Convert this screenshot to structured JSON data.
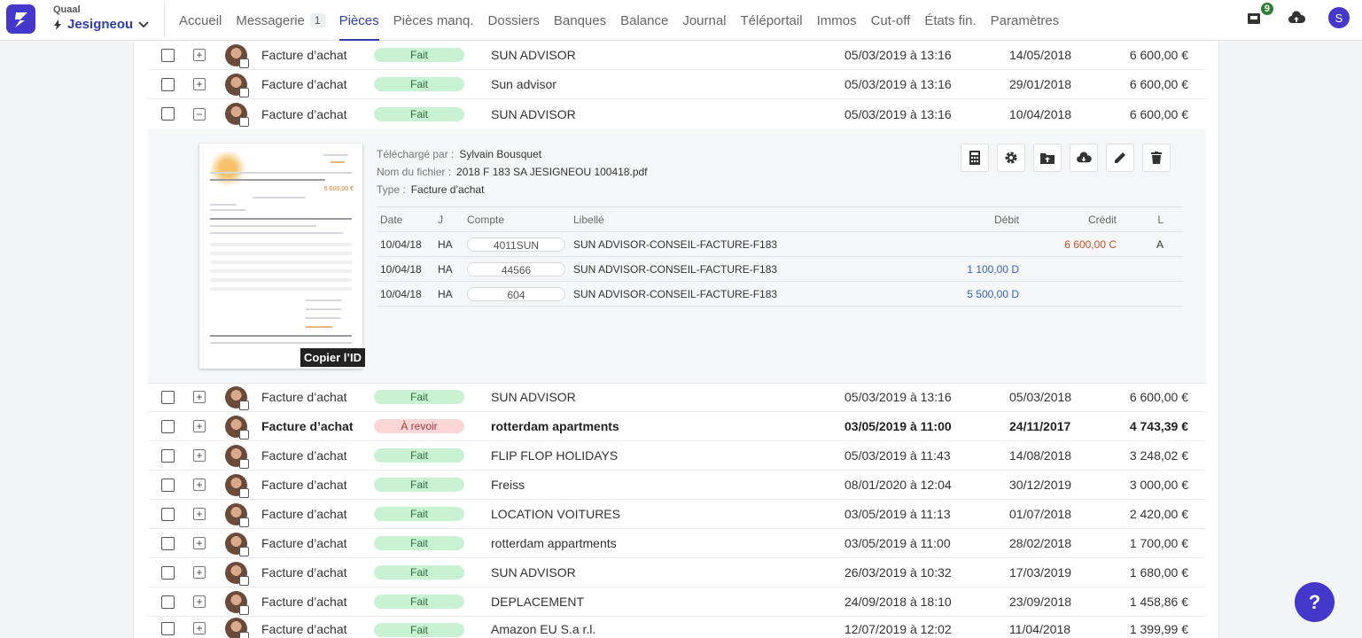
{
  "header": {
    "company_label": "Quaal",
    "company_name": "Jesigneou",
    "nav": [
      {
        "label": "Accueil"
      },
      {
        "label": "Messagerie",
        "badge": "1"
      },
      {
        "label": "Pièces",
        "active": true
      },
      {
        "label": "Pièces manq."
      },
      {
        "label": "Dossiers"
      },
      {
        "label": "Banques"
      },
      {
        "label": "Balance"
      },
      {
        "label": "Journal"
      },
      {
        "label": "Téléportail"
      },
      {
        "label": "Immos"
      },
      {
        "label": "Cut-off"
      },
      {
        "label": "États fin."
      },
      {
        "label": "Paramètres"
      }
    ],
    "notif_count": "9",
    "user_initial": "S"
  },
  "rows_top": [
    {
      "type": "Facture d’achat",
      "status": "Fait",
      "vendor": "SUN ADVISOR",
      "uploaded": "05/03/2019 à 13:16",
      "date": "14/05/2018",
      "amount": "6 600,00 €"
    },
    {
      "type": "Facture d’achat",
      "status": "Fait",
      "vendor": "Sun advisor",
      "uploaded": "05/03/2019 à 13:16",
      "date": "29/01/2018",
      "amount": "6 600,00 €"
    },
    {
      "type": "Facture d’achat",
      "status": "Fait",
      "vendor": "SUN ADVISOR",
      "uploaded": "05/03/2019 à 13:16",
      "date": "10/04/2018",
      "amount": "6 600,00 €"
    }
  ],
  "detail": {
    "uploaded_by_label": "Téléchargé par :",
    "uploaded_by": "Sylvain Bousquet",
    "filename_label": "Nom du fichier :",
    "filename": "2018 F 183 SA JESIGNEOU 100418.pdf",
    "type_label": "Type :",
    "type": "Facture d’achat",
    "copy_id": "Copier l’ID",
    "thumb_price": "6 600,00 €",
    "columns": {
      "date": "Date",
      "journal": "J",
      "account": "Compte",
      "label": "Libellé",
      "debit": "Débit",
      "credit": "Crédit",
      "letter": "L"
    },
    "entries": [
      {
        "date": "10/04/18",
        "journal": "HA",
        "account": "4011SUN",
        "label": "SUN ADVISOR-CONSEIL-FACTURE-F183",
        "debit": "",
        "credit": "6 600,00 C",
        "letter": "A"
      },
      {
        "date": "10/04/18",
        "journal": "HA",
        "account": "44566",
        "label": "SUN ADVISOR-CONSEIL-FACTURE-F183",
        "debit": "1 100,00 D",
        "credit": "",
        "letter": ""
      },
      {
        "date": "10/04/18",
        "journal": "HA",
        "account": "604",
        "label": "SUN ADVISOR-CONSEIL-FACTURE-F183",
        "debit": "5 500,00 D",
        "credit": "",
        "letter": ""
      }
    ]
  },
  "rows_bottom": [
    {
      "type": "Facture d’achat",
      "status": "Fait",
      "vendor": "SUN ADVISOR",
      "uploaded": "05/03/2019 à 13:16",
      "date": "05/03/2018",
      "amount": "6 600,00 €"
    },
    {
      "type": "Facture d’achat",
      "status": "À revoir",
      "vendor": "rotterdam apartments",
      "uploaded": "03/05/2019 à 11:00",
      "date": "24/11/2017",
      "amount": "4 743,39 €",
      "bold": true
    },
    {
      "type": "Facture d’achat",
      "status": "Fait",
      "vendor": "FLIP FLOP HOLIDAYS",
      "uploaded": "05/03/2019 à 11:43",
      "date": "14/08/2018",
      "amount": "3 248,02 €"
    },
    {
      "type": "Facture d’achat",
      "status": "Fait",
      "vendor": "Freiss",
      "uploaded": "08/01/2020 à 12:04",
      "date": "30/12/2019",
      "amount": "3 000,00 €"
    },
    {
      "type": "Facture d’achat",
      "status": "Fait",
      "vendor": "LOCATION VOITURES",
      "uploaded": "03/05/2019 à 11:13",
      "date": "01/07/2018",
      "amount": "2 420,00 €"
    },
    {
      "type": "Facture d’achat",
      "status": "Fait",
      "vendor": "rotterdam appartments",
      "uploaded": "03/05/2019 à 11:00",
      "date": "28/02/2018",
      "amount": "1 700,00 €"
    },
    {
      "type": "Facture d’achat",
      "status": "Fait",
      "vendor": "SUN ADVISOR",
      "uploaded": "26/03/2019 à 10:32",
      "date": "17/03/2019",
      "amount": "1 680,00 €"
    },
    {
      "type": "Facture d’achat",
      "status": "Fait",
      "vendor": "DEPLACEMENT",
      "uploaded": "24/09/2018 à 18:10",
      "date": "23/09/2018",
      "amount": "1 458,86 €"
    },
    {
      "type": "Facture d’achat",
      "status": "Fait",
      "vendor": "Amazon EU S.a r.l.",
      "uploaded": "12/07/2019 à 12:02",
      "date": "11/04/2018",
      "amount": "1 399,99 €"
    }
  ],
  "help_label": "?"
}
